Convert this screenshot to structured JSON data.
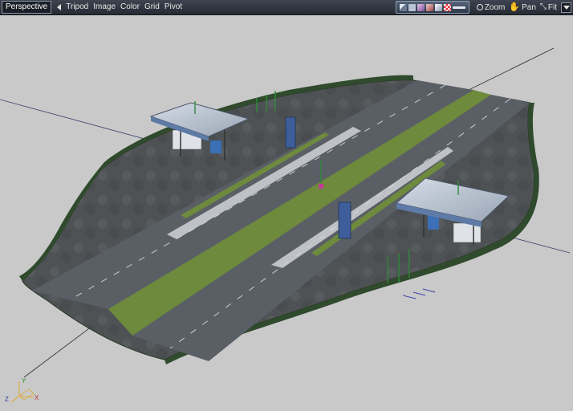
{
  "toolbar": {
    "view": "Perspective",
    "menus": [
      "Tripod",
      "Image",
      "Color",
      "Grid",
      "Pivot"
    ],
    "nav": {
      "zoom": "Zoom",
      "pan": "Pan",
      "fit": "Fit"
    }
  },
  "gizmo": {
    "x": "X",
    "y": "Y",
    "z": "Z"
  },
  "colors": {
    "background": "#c9c9c9",
    "road": "#5a5f66",
    "grass": "#6e8a3c",
    "fence": "#2f4a2c",
    "canopy": "#b9c3d1",
    "sign": "#3d5e9a"
  },
  "icons": [
    "arrow-left-icon",
    "tool-strip-icons",
    "zoom-icon",
    "pan-hand-icon",
    "fit-icon",
    "dropdown-icon"
  ]
}
